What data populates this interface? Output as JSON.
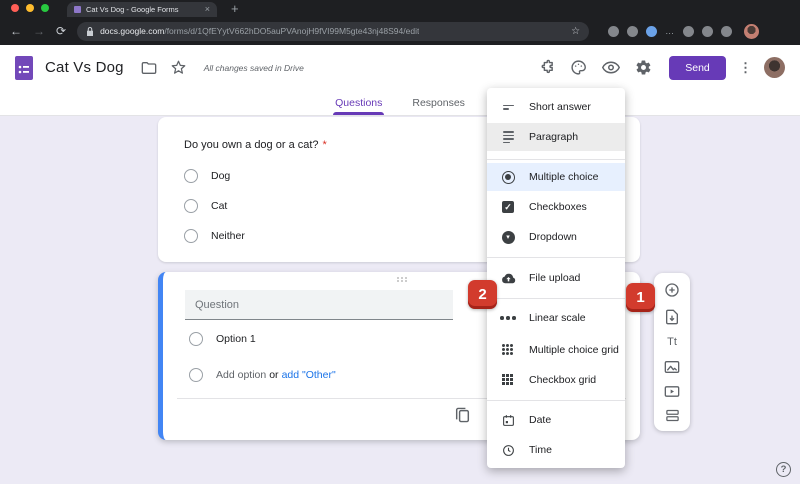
{
  "browser": {
    "tab_title": "Cat Vs Dog - Google Forms",
    "close_tab": "×",
    "new_tab": "+",
    "back": "←",
    "forward": "→",
    "reload": "⟳",
    "url_host": "docs.google.com",
    "url_path": "/forms/d/1QfEYytV662hDO5auPVAnojH9fVI99M5gte43nj48S94/edit",
    "bookmark_star": "☆",
    "extensions_dots": "…"
  },
  "header": {
    "app_title": "Cat Vs Dog",
    "save_status": "All changes saved in Drive",
    "send_label": "Send",
    "kebab": "⋮"
  },
  "tabs": {
    "questions": "Questions",
    "responses": "Responses"
  },
  "question1": {
    "title": "Do you own a dog or a cat?",
    "required_mark": "*",
    "options": {
      "0": "Dog",
      "1": "Cat",
      "2": "Neither"
    }
  },
  "question2": {
    "placeholder": "Question",
    "option1": "Option 1",
    "add_option": "Add option",
    "or": "or",
    "add_other": "add \"Other\""
  },
  "menu": {
    "items": {
      "0": {
        "label": "Short answer"
      },
      "1": {
        "label": "Paragraph"
      },
      "2": {
        "label": "Multiple choice"
      },
      "3": {
        "label": "Checkboxes"
      },
      "4": {
        "label": "Dropdown"
      },
      "5": {
        "label": "File upload"
      },
      "6": {
        "label": "Linear scale"
      },
      "7": {
        "label": "Multiple choice grid"
      },
      "8": {
        "label": "Checkbox grid"
      },
      "9": {
        "label": "Date"
      },
      "10": {
        "label": "Time"
      }
    },
    "dropdown_caret": "▾",
    "checkbox_check": "✓"
  },
  "toolbar": {
    "text_button": "Tt"
  },
  "badges": {
    "one": "1",
    "two": "2"
  },
  "help_label": "?",
  "colors": {
    "accent_purple": "#673ab7",
    "active_card_blue": "#4285f4",
    "link_blue": "#1a73e8",
    "badge_red": "#d23b2d",
    "canvas_lavender": "#eceaf5"
  }
}
